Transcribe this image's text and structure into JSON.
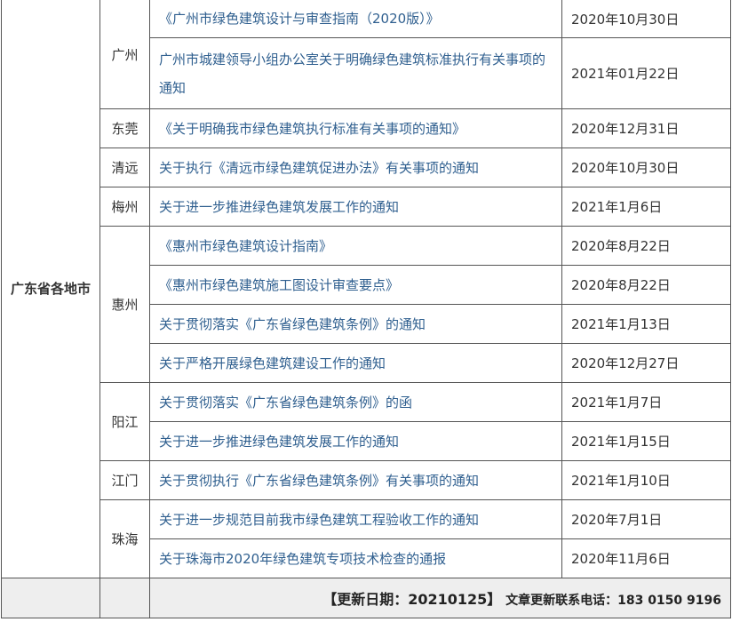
{
  "province": "广东省各地市",
  "groups": [
    {
      "city": "广州",
      "rows": [
        {
          "title": "《广州市绿色建筑设计与审查指南（2020版）》",
          "date": "2020年10月30日"
        },
        {
          "title": "广州市城建领导小组办公室关于明确绿色建筑标准执行有关事项的通知",
          "date": "2021年01月22日"
        }
      ]
    },
    {
      "city": "东莞",
      "rows": [
        {
          "title": "《关于明确我市绿色建筑执行标准有关事项的通知》",
          "date": "2020年12月31日"
        }
      ]
    },
    {
      "city": "清远",
      "rows": [
        {
          "title": "关于执行《清远市绿色建筑促进办法》有关事项的通知",
          "date": "2020年10月30日"
        }
      ]
    },
    {
      "city": "梅州",
      "rows": [
        {
          "title": "关于进一步推进绿色建筑发展工作的通知",
          "date": "2021年1月6日"
        }
      ]
    },
    {
      "city": "惠州",
      "rows": [
        {
          "title": "《惠州市绿色建筑设计指南》",
          "date": "2020年8月22日"
        },
        {
          "title": "《惠州市绿色建筑施工图设计审查要点》",
          "date": "2020年8月22日"
        },
        {
          "title": "关于贯彻落实《广东省绿色建筑条例》的通知",
          "date": "2021年1月13日"
        },
        {
          "title": "关于严格开展绿色建筑建设工作的通知",
          "date": "2020年12月27日"
        }
      ]
    },
    {
      "city": "阳江",
      "rows": [
        {
          "title": "关于贯彻落实《广东省绿色建筑条例》的函",
          "date": "2021年1月7日"
        },
        {
          "title": "关于进一步推进绿色建筑发展工作的通知",
          "date": "2021年1月15日"
        }
      ]
    },
    {
      "city": "江门",
      "rows": [
        {
          "title": "关于贯彻执行《广东省绿色建筑条例》有关事项的通知",
          "date": "2021年1月10日"
        }
      ]
    },
    {
      "city": "珠海",
      "rows": [
        {
          "title": "关于进一步规范目前我市绿色建筑工程验收工作的通知",
          "date": "2020年7月1日"
        },
        {
          "title": "关于珠海市2020年绿色建筑专项技术检查的通报",
          "date": "2020年11月6日"
        }
      ]
    }
  ],
  "footer": {
    "updated": "【更新日期：20210125】",
    "contact": "文章更新联系电话：183 0150 9196"
  }
}
